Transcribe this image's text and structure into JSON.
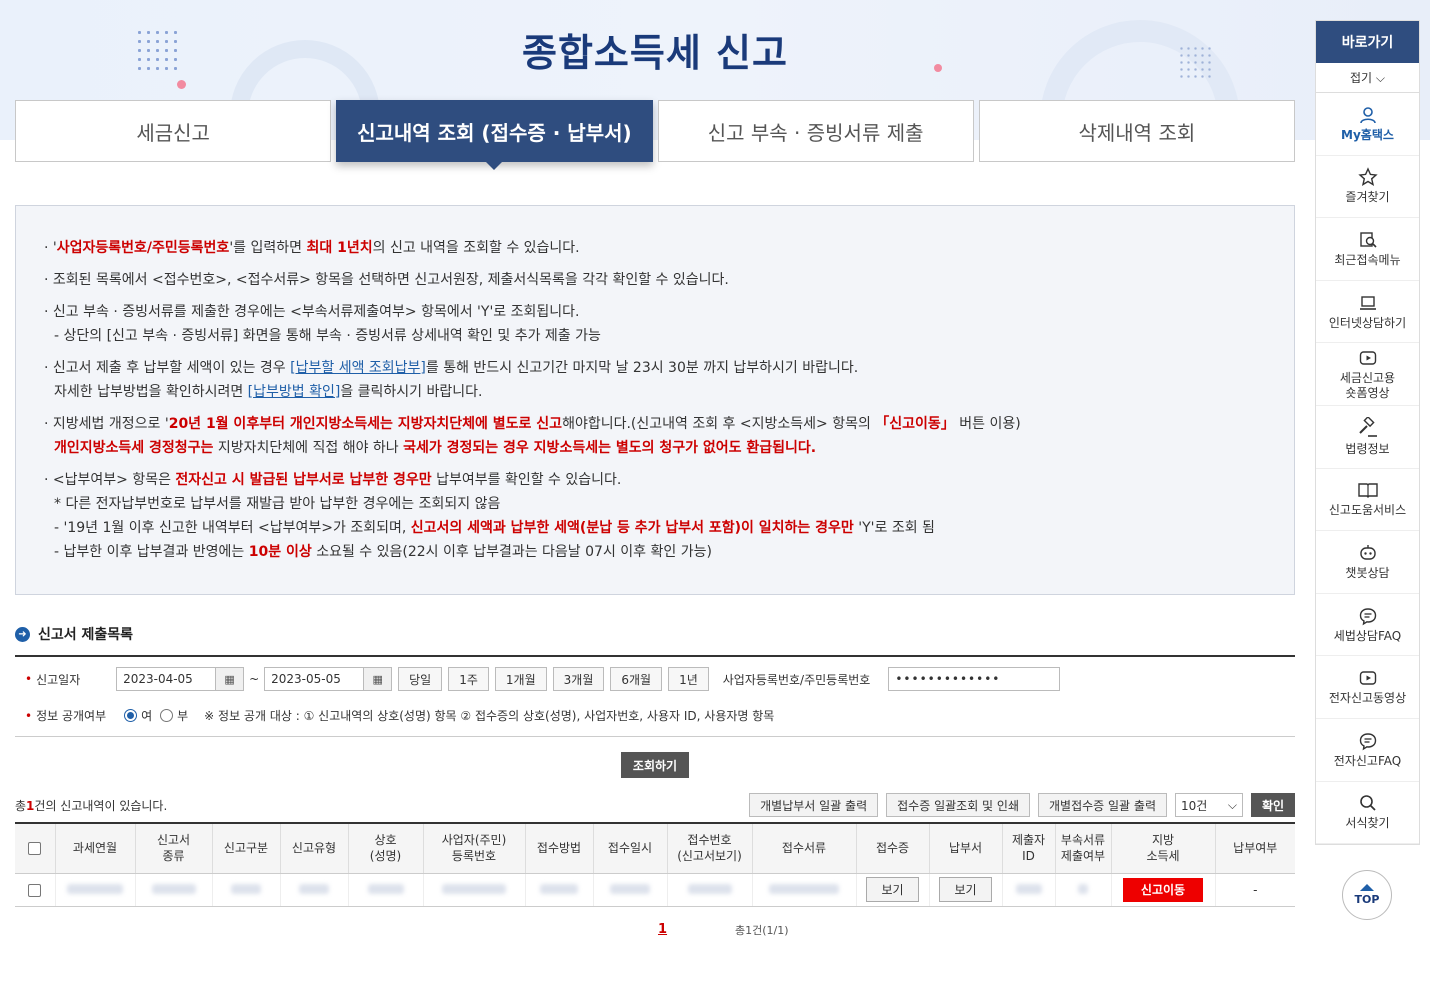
{
  "page_title": "종합소득세 신고",
  "tabs": [
    {
      "label": "세금신고",
      "active": false
    },
    {
      "label": "신고내역 조회 (접수증 · 납부서)",
      "active": true
    },
    {
      "label": "신고 부속 · 증빙서류 제출",
      "active": false
    },
    {
      "label": "삭제내역 조회",
      "active": false
    }
  ],
  "notice": {
    "l1a": "· '",
    "l1b": "사업자등록번호/주민등록번호",
    "l1c": "'를 입력하면 ",
    "l1d": "최대 1년치",
    "l1e": "의 신고 내역을 조회할 수 있습니다.",
    "l2": "· 조회된 목록에서 <접수번호>, <접수서류> 항목을 선택하면 신고서원장, 제출서식목록을 각각 확인할 수 있습니다.",
    "l3": "· 신고 부속 · 증빙서류를 제출한 경우에는 <부속서류제출여부> 항목에서 'Y'로 조회됩니다.",
    "l3s": "- 상단의 [신고 부속 · 증빙서류] 화면을 통해 부속 · 증빙서류 상세내역 확인 및 추가 제출 가능",
    "l4a": "· 신고서 제출 후 납부할 세액이 있는 경우 ",
    "l4b": "[납부할 세액 조회납부]",
    "l4c": "를 통해 반드시 신고기간 마지막 날 23시 30분 까지 납부하시기 바랍니다.",
    "l4sa": "자세한 납부방법을 확인하시려면 ",
    "l4sb": "[납부방법 확인]",
    "l4sc": "을 클릭하시기 바랍니다.",
    "l5a": "· 지방세법 개정으로 '",
    "l5b": "20년 1월 이후부터 개인지방소득세는 지방자치단체에 별도로 신고",
    "l5c": "해야합니다.(신고내역 조회 후 <지방소득세> 항목의 ",
    "l5d": "「신고이동」",
    "l5e": " 버튼 이용)",
    "l5sa": "개인지방소득세 경정청구는",
    "l5sb": " 지방자치단체에 직접 해야 하나 ",
    "l5sc": "국세가 경정되는 경우 지방소득세는 별도의 청구가 없어도 환급됩니다.",
    "l6a": "· <납부여부> 항목은 ",
    "l6b": "전자신고 시 발급된 납부서로 납부한 경우만",
    "l6c": " 납부여부를 확인할 수 있습니다.",
    "l6s1": " * 다른 전자납부번호로 납부서를 재발급 받아 납부한 경우에는 조회되지 않음",
    "l6s2a": "- '19년 1월 이후 신고한 내역부터 <납부여부>가 조회되며, ",
    "l6s2b": "신고서의 세액과 납부한 세액(분납 등 추가 납부서 포함)이 일치하는 경우만",
    "l6s2c": " 'Y'로 조회 됨",
    "l6s3a": "- 납부한 이후 납부결과 반영에는 ",
    "l6s3b": "10분 이상",
    "l6s3c": " 소요될 수 있음(22시 이후 납부결과는 다음날 07시 이후 확인 가능)"
  },
  "section_title": "신고서 제출목록",
  "search": {
    "date_label": "신고일자",
    "date_from": "2023-04-05",
    "date_to": "2023-05-05",
    "cal_icon": "▦",
    "tilde": "~",
    "periods": [
      "당일",
      "1주",
      "1개월",
      "3개월",
      "6개월",
      "1년"
    ],
    "id_label": "사업자등록번호/주민등록번호",
    "id_value": "•••••••••••••",
    "disclosure_label": "정보 공개여부",
    "yes": "여",
    "no": "부",
    "disclosure_info": "※ 정보 공개 대상 : ① 신고내역의 상호(성명) 항목 ② 접수증의 상호(성명), 사업자번호, 사용자 ID, 사용자명 항목"
  },
  "query_button": "조회하기",
  "total": {
    "prefix": "총",
    "count": "1",
    "suffix": "건의 신고내역이 있습니다."
  },
  "actions": [
    "개별납부서 일괄 출력",
    "접수증 일괄조회 및 인쇄",
    "개별접수증 일괄 출력"
  ],
  "page_size": "10건",
  "confirm_button": "확인",
  "table": {
    "headers": [
      "과세연월",
      "신고서\n종류",
      "신고구분",
      "신고유형",
      "상호\n(성명)",
      "사업자(주민)\n등록번호",
      "접수방법",
      "접수일시",
      "접수번호\n(신고서보기)",
      "접수서류",
      "접수증",
      "납부서",
      "제출자\nID",
      "부속서류\n제출여부",
      "지방\n소득세",
      "납부여부"
    ],
    "row": {
      "view1": "보기",
      "view2": "보기",
      "move": "신고이동",
      "paid": "-"
    }
  },
  "pagination": {
    "current": "1",
    "info": "총1건(1/1)"
  },
  "quick_nav": {
    "title": "바로가기",
    "fold": "접기 ⌵",
    "items": [
      "My홈택스",
      "즐겨찾기",
      "최근접속메뉴",
      "인터넷상담하기",
      "세금신고용\n숏폼영상",
      "법령정보",
      "신고도움서비스",
      "챗봇상담",
      "세법상담FAQ",
      "전자신고동영상",
      "전자신고FAQ",
      "서식찾기"
    ]
  },
  "top_button": "TOP"
}
